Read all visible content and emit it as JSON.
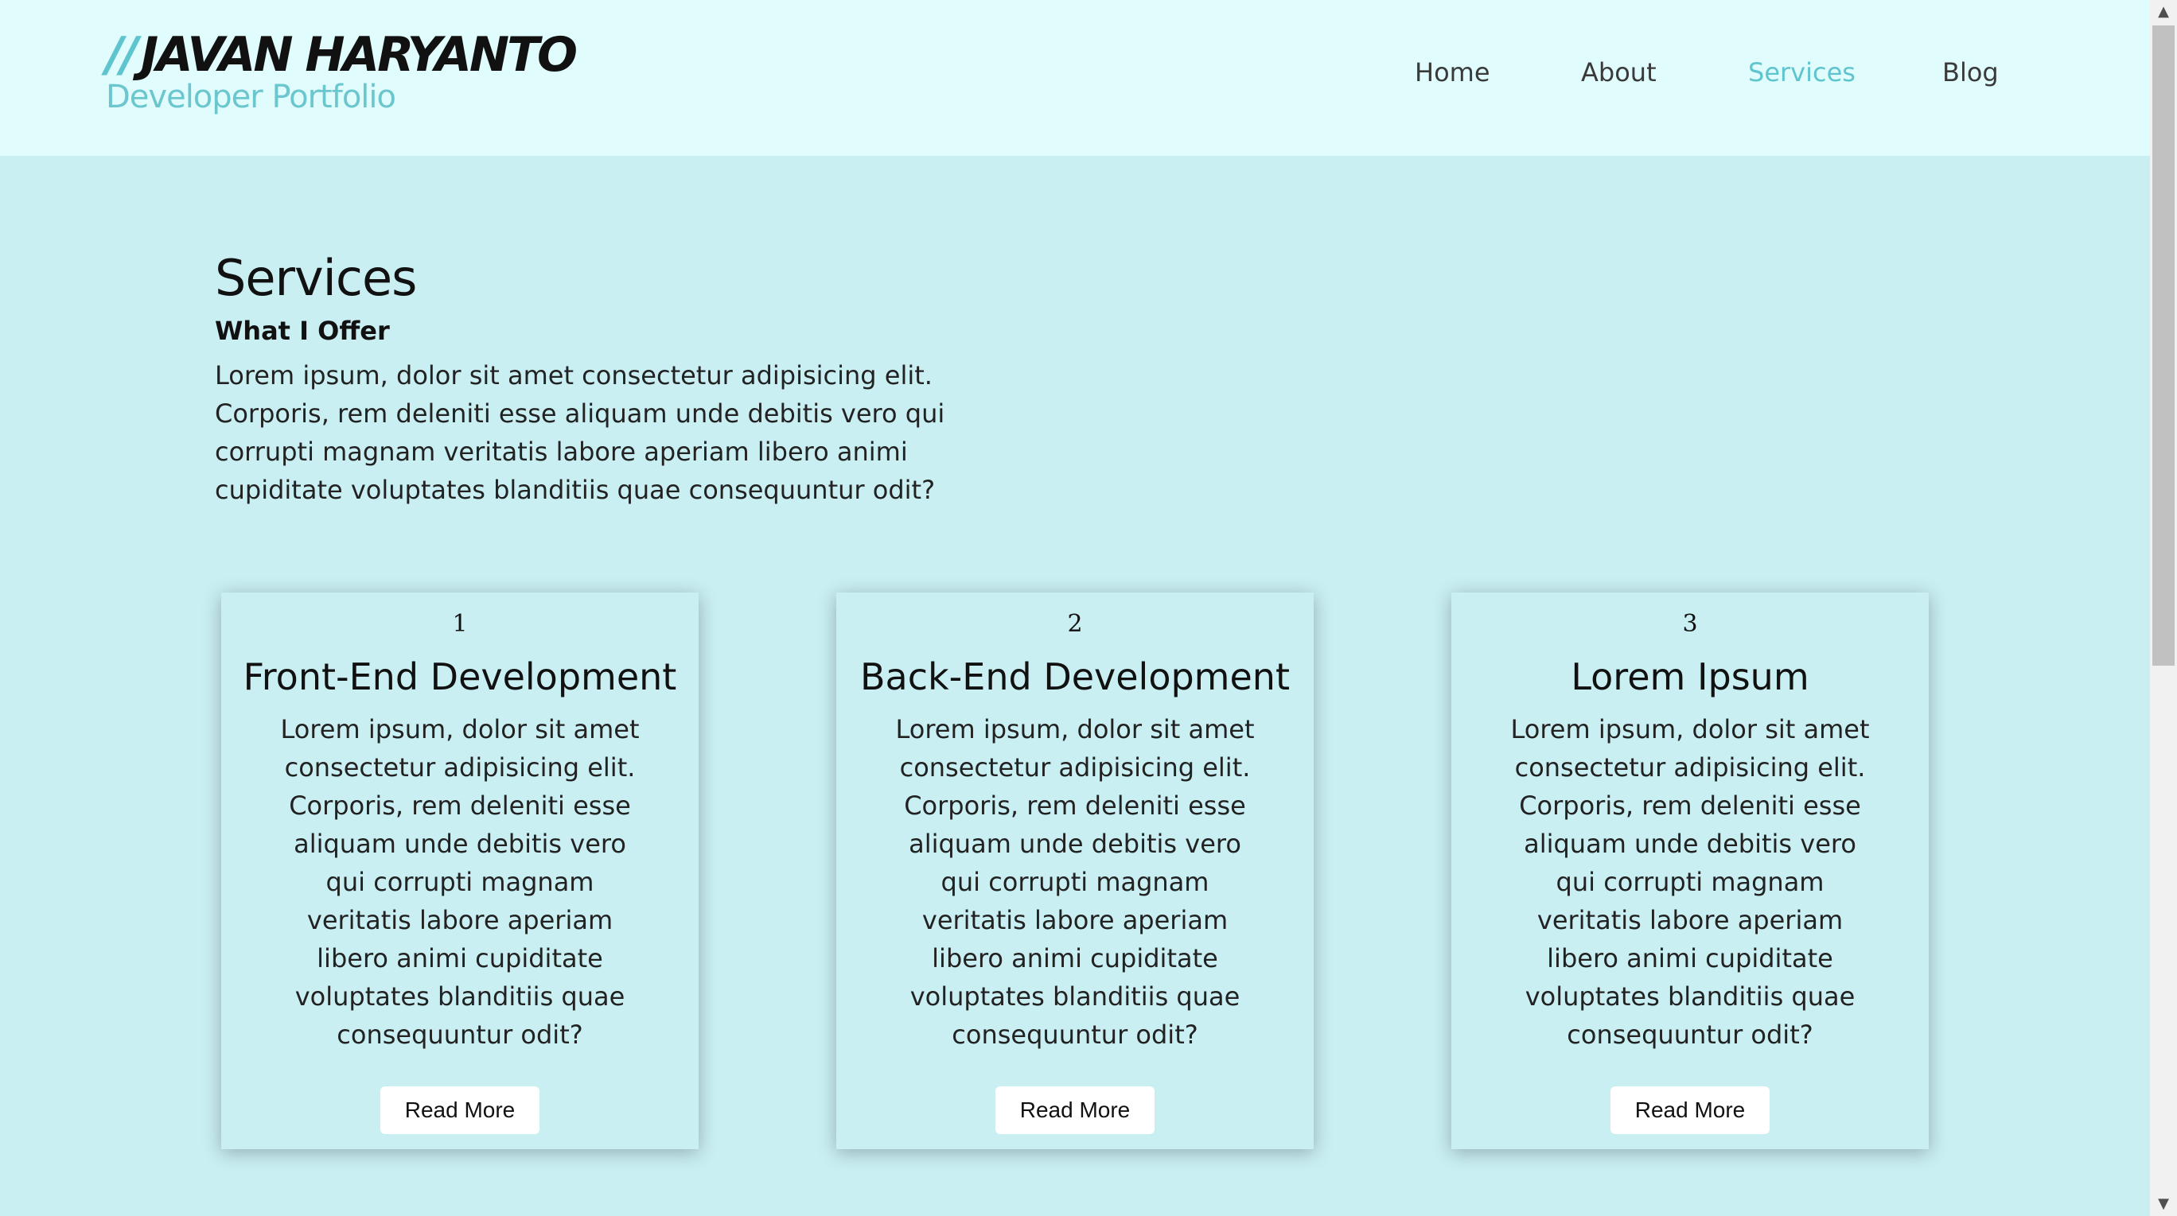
{
  "logo": {
    "slashes": "//",
    "name": "JAVAN HARYANTO",
    "subtitle": "Developer Portfolio"
  },
  "nav": {
    "items": [
      {
        "label": "Home",
        "active": false
      },
      {
        "label": "About",
        "active": false
      },
      {
        "label": "Services",
        "active": true
      },
      {
        "label": "Blog",
        "active": false
      }
    ]
  },
  "services": {
    "title": "Services",
    "subtitle": "What I Offer",
    "description": "Lorem ipsum, dolor sit amet consectetur adipisicing elit. Corporis, rem deleniti esse aliquam unde debitis vero qui corrupti magnam veritatis labore aperiam libero animi cupiditate voluptates blanditiis quae consequuntur odit?"
  },
  "cards": [
    {
      "number": "1",
      "title": "Front-End Development",
      "text": "Lorem ipsum, dolor sit amet consectetur adipisicing elit. Corporis, rem deleniti esse aliquam unde debitis vero qui corrupti magnam veritatis labore aperiam libero animi cupiditate voluptates blanditiis quae consequuntur odit?",
      "button": "Read More"
    },
    {
      "number": "2",
      "title": "Back-End Development",
      "text": "Lorem ipsum, dolor sit amet consectetur adipisicing elit. Corporis, rem deleniti esse aliquam unde debitis vero qui corrupti magnam veritatis labore aperiam libero animi cupiditate voluptates blanditiis quae consequuntur odit?",
      "button": "Read More"
    },
    {
      "number": "3",
      "title": "Lorem Ipsum",
      "text": "Lorem ipsum, dolor sit amet consectetur adipisicing elit. Corporis, rem deleniti esse aliquam unde debitis vero qui corrupti magnam veritatis labore aperiam libero animi cupiditate voluptates blanditiis quae consequuntur odit?",
      "button": "Read More"
    }
  ],
  "colors": {
    "header_bg": "#e0fcfd",
    "page_bg": "#c9eff3",
    "accent": "#5ec4cd",
    "text": "#111111"
  },
  "scrollbar": {
    "up_icon": "scroll-up-arrow-icon",
    "down_icon": "scroll-down-arrow-icon"
  }
}
